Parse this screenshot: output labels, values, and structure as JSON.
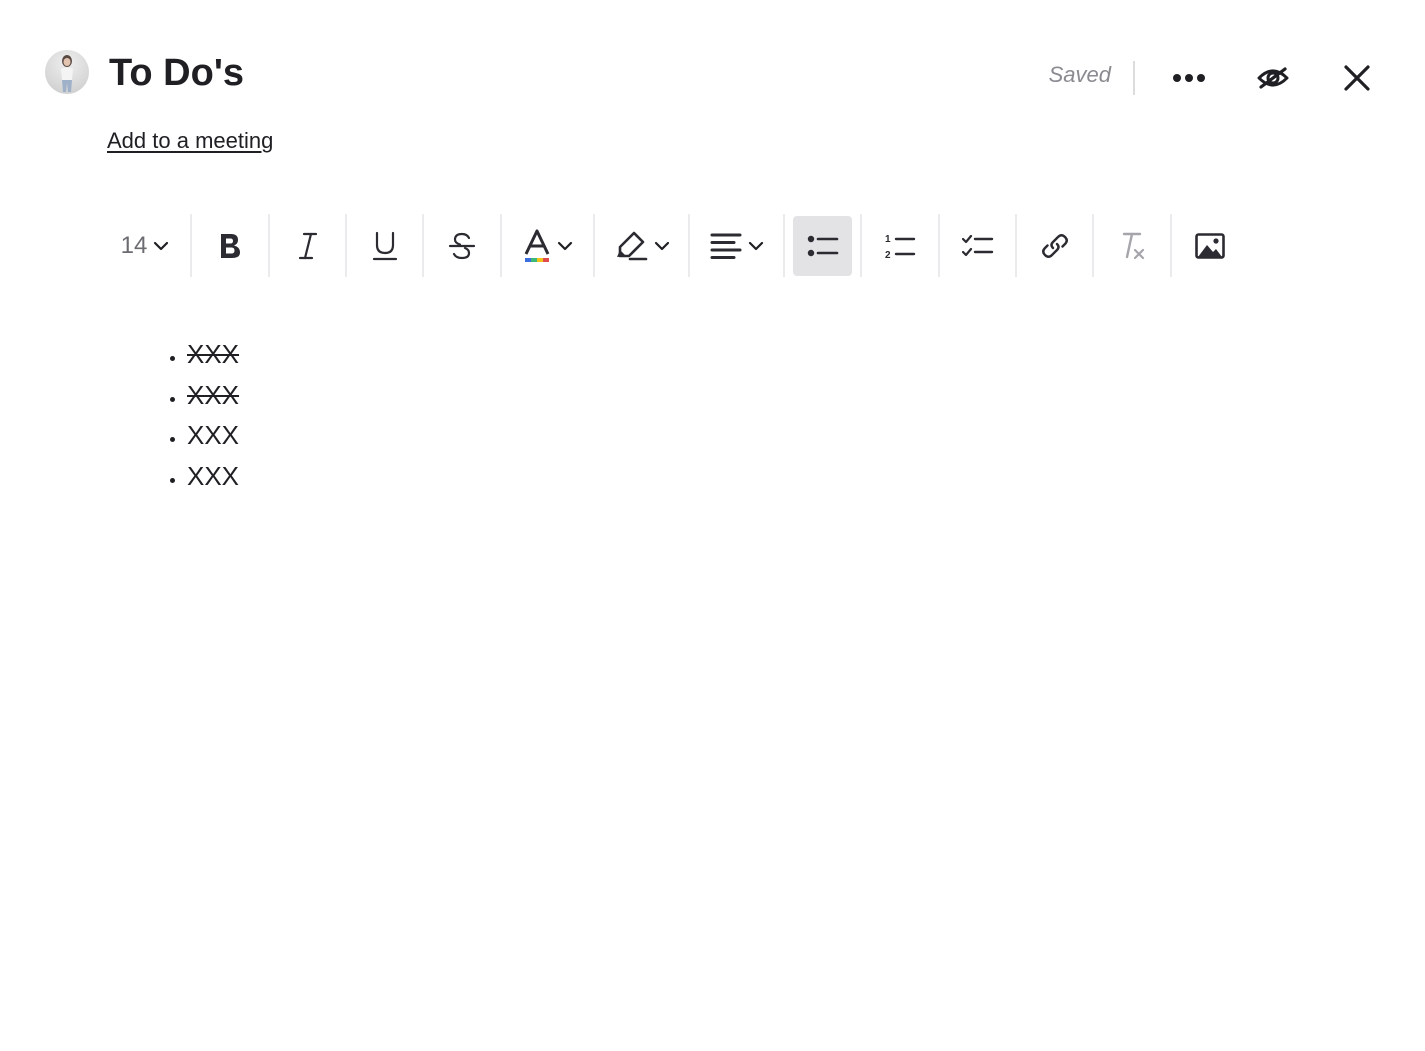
{
  "header": {
    "title": "To Do's",
    "add_meeting_label": "Add to a meeting",
    "status": "Saved"
  },
  "toolbar": {
    "font_size": "14",
    "active_tool": "bulleted-list"
  },
  "content": {
    "list_items": [
      {
        "text": "XXX",
        "completed": true
      },
      {
        "text": "XXX",
        "completed": true
      },
      {
        "text": "XXX",
        "completed": false
      },
      {
        "text": "XXX",
        "completed": false
      }
    ]
  },
  "colors": {
    "text": "#1f1f24",
    "muted": "#8a8a90",
    "active_tool_bg": "#e3e3e5",
    "clear_format_icon": "#a5a5ab"
  }
}
